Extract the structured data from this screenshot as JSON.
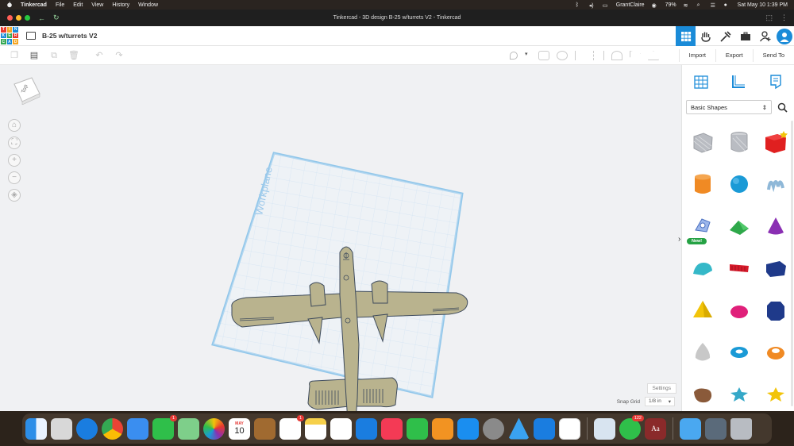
{
  "menubar": {
    "app_name": "Tinkercad",
    "menus": [
      "File",
      "Edit",
      "View",
      "History",
      "Window"
    ],
    "user": "GrantClaire",
    "battery": "79%",
    "datetime": "Sat May 10  1:39 PM"
  },
  "browser": {
    "title": "Tinkercad - 3D design B-25 w/turrets V2 - Tinkercad"
  },
  "header": {
    "logo_letters": [
      "T",
      "I",
      "N",
      "K",
      "E",
      "R",
      "C",
      "A",
      "D"
    ],
    "design_name": "B-25 w/turrets V2"
  },
  "toolbar": {
    "actions": {
      "import": "Import",
      "export": "Export",
      "send_to": "Send To"
    }
  },
  "viewport": {
    "viewcube_label": "Top",
    "workplane_label": "Workplane",
    "settings_label": "Settings",
    "snap_grid_label": "Snap Grid",
    "snap_grid_value": "1/8 in"
  },
  "panel": {
    "category": "Basic Shapes",
    "new_badge": "New!",
    "shapes": [
      {
        "name": "box-hole",
        "color": "#b9bcc2"
      },
      {
        "name": "cylinder-hole",
        "color": "#b9bcc2"
      },
      {
        "name": "box",
        "color": "#e02020"
      },
      {
        "name": "cylinder",
        "color": "#f08a24"
      },
      {
        "name": "sphere",
        "color": "#1a9ad6"
      },
      {
        "name": "scribble",
        "color": "#8fb8d8"
      },
      {
        "name": "shape-generator",
        "color": "#6b8fd6"
      },
      {
        "name": "roof",
        "color": "#2ea84a"
      },
      {
        "name": "cone",
        "color": "#8a2fb3"
      },
      {
        "name": "round-roof",
        "color": "#35b8c8"
      },
      {
        "name": "text",
        "color": "#d61a2a"
      },
      {
        "name": "wedge",
        "color": "#1f3a8a"
      },
      {
        "name": "pyramid",
        "color": "#f2c40a"
      },
      {
        "name": "half-sphere",
        "color": "#e0207a"
      },
      {
        "name": "polygon",
        "color": "#1f3a8a"
      },
      {
        "name": "paraboloid",
        "color": "#c8c8c8"
      },
      {
        "name": "torus",
        "color": "#1a9ad6"
      },
      {
        "name": "tube",
        "color": "#f08a24"
      },
      {
        "name": "rock",
        "color": "#8a5a3a"
      },
      {
        "name": "star",
        "color": "#35a8c8"
      },
      {
        "name": "star-gold",
        "color": "#f2c40a"
      }
    ]
  },
  "dock": {
    "badges": {
      "facetime": "1",
      "reminders": "1",
      "messages": "122"
    },
    "calendar_month": "MAY",
    "calendar_day": "10"
  }
}
